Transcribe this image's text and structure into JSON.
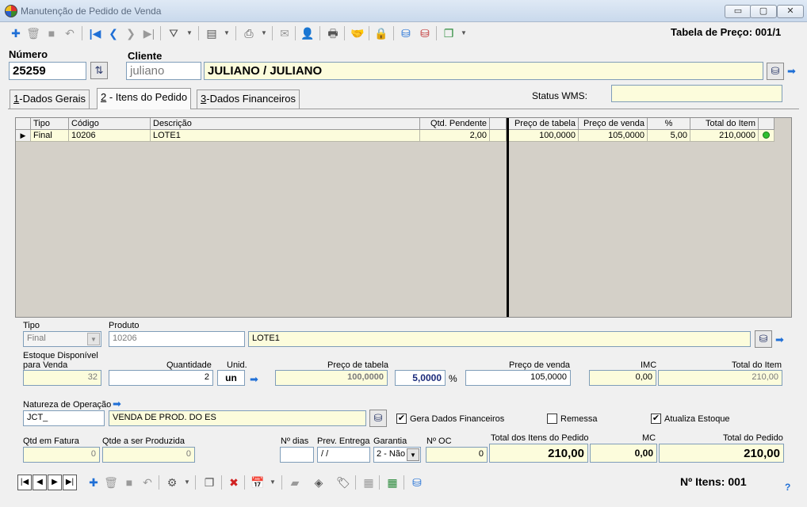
{
  "window": {
    "title": "Manutenção de Pedido de Venda",
    "minimize_symbol": "▭",
    "maximize_symbol": "▢",
    "close_symbol": "✕"
  },
  "toolbar": {
    "price_table": "Tabela de Preço: 001/1",
    "icons": [
      "add-icon",
      "delete-icon",
      "save-icon",
      "undo-icon",
      "first-icon",
      "prev-icon",
      "next-icon",
      "last-icon",
      "filter-icon",
      "calculator-icon",
      "report-icon",
      "email-icon",
      "user-icon",
      "print-icon",
      "handshake-icon",
      "lock-icon",
      "database-icon",
      "database-export-icon",
      "copy-icon"
    ]
  },
  "header": {
    "numero_label": "Número",
    "numero_value": "25259",
    "cliente_label": "Cliente",
    "cliente_code": "juliano",
    "cliente_name": "JULIANO / JULIANO",
    "status_wms_label": "Status WMS:",
    "status_wms_value": ""
  },
  "tabs": [
    {
      "key": "1",
      "label": "-Dados Gerais",
      "active": false
    },
    {
      "key": "2",
      "label": " - Itens do Pedido",
      "active": true
    },
    {
      "key": "3",
      "label": "-Dados Financeiros",
      "active": false
    }
  ],
  "grid": {
    "headers": {
      "tipo": "Tipo",
      "codigo": "Código",
      "descricao": "Descrição",
      "qtd_pendente": "Qtd. Pendente",
      "preco_tabela": "Preço de tabela",
      "preco_venda": "Preço de venda",
      "percent": "%",
      "total_item": "Total do Item"
    },
    "rows": [
      {
        "tipo": "Final",
        "codigo": "10206",
        "descricao": "LOTE1",
        "qtd_pendente": "2,00",
        "preco_tabela": "100,0000",
        "preco_venda": "105,0000",
        "percent": "5,00",
        "total_item": "210,0000",
        "status_color": "#2fbf2f"
      }
    ]
  },
  "item_form": {
    "tipo_label": "Tipo",
    "tipo_value": "Final",
    "produto_label": "Produto",
    "produto_code": "10206",
    "produto_desc": "LOTE1",
    "estoque_label_1": "Estoque Disponível",
    "estoque_label_2": "para Venda",
    "estoque_value": "32",
    "quantidade_label": "Quantidade",
    "quantidade_value": "2",
    "unid_label": "Unid.",
    "unid_value": "un",
    "preco_tabela_label": "Preço de tabela",
    "preco_tabela_value": "100,0000",
    "percent_value": "5,0000",
    "percent_symbol": "%",
    "preco_venda_label": "Preço de venda",
    "preco_venda_value": "105,0000",
    "imc_label": "IMC",
    "imc_value": "0,00",
    "total_item_label": "Total do Item",
    "total_item_value": "210,00",
    "natureza_label": "Natureza de Operação",
    "natureza_code": "JCT_",
    "natureza_desc": "VENDA DE PROD. DO ES",
    "gera_financeiros_label": "Gera Dados Financeiros",
    "gera_financeiros_checked": true,
    "remessa_label": "Remessa",
    "remessa_checked": false,
    "atualiza_estoque_label": "Atualiza Estoque",
    "atualiza_estoque_checked": true,
    "qtd_fatura_label": "Qtd em Fatura",
    "qtd_fatura_value": "0",
    "qtde_produzida_label": "Qtde a ser Produzida",
    "qtde_produzida_value": "0",
    "n_dias_label": "Nº dias",
    "n_dias_value": "",
    "prev_entrega_label": "Prev. Entrega",
    "prev_entrega_value": " / /",
    "garantia_label": "Garantia",
    "garantia_value": "2 - Não",
    "n_oc_label": "Nº OC",
    "n_oc_value": "0"
  },
  "totals": {
    "total_itens_label": "Total dos Itens do Pedido",
    "total_itens_value": "210,00",
    "mc_label": "MC",
    "mc_value": "0,00",
    "total_pedido_label": "Total do Pedido",
    "total_pedido_value": "210,00"
  },
  "footer": {
    "items_count": "Nº Itens: 001"
  }
}
